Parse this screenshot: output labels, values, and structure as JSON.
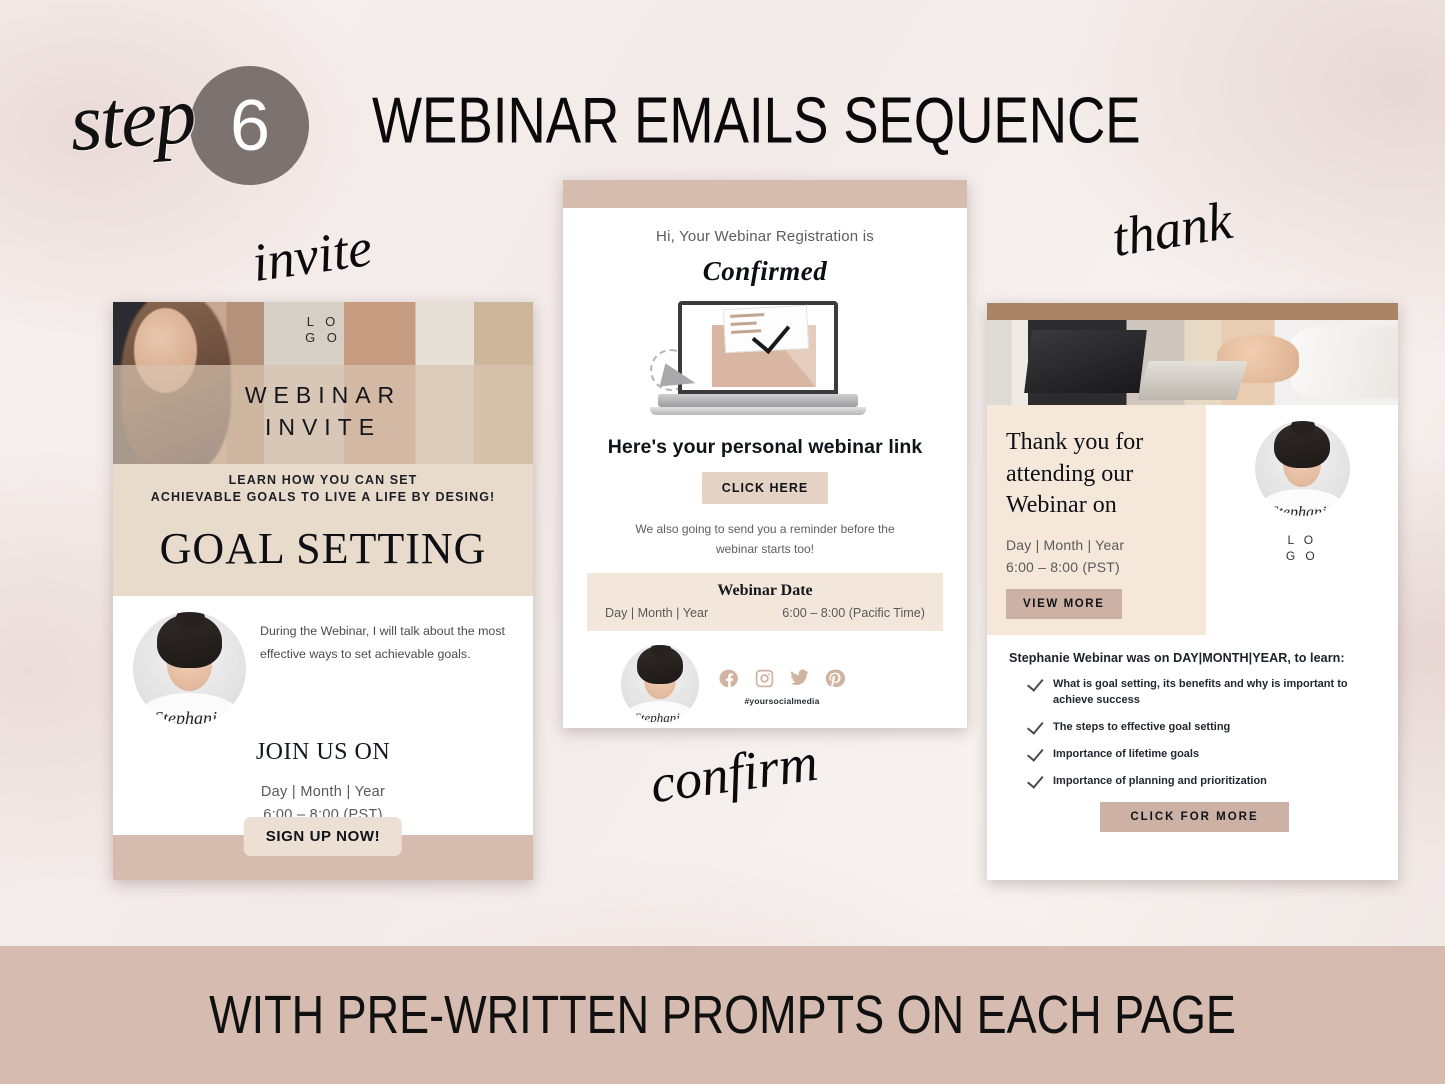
{
  "header": {
    "step_word": "step",
    "step_number": "6",
    "title": "WEBINAR EMAILS SEQUENCE"
  },
  "labels": {
    "invite": "invite",
    "thank": "thank",
    "confirm": "confirm"
  },
  "colors": {
    "background": "#f3ecea",
    "banner": "#d6bcb0",
    "badge": "#7c7270",
    "accent_tan": "#d6bcaf",
    "accent_cream": "#f5e7da",
    "cta_tan": "#ccb1a4"
  },
  "invite_card": {
    "logo_line1": "L O",
    "logo_line2": "G O",
    "overlay_line1": "WEBINAR",
    "overlay_line2": "INVITE",
    "sub_line1": "LEARN HOW YOU CAN SET",
    "sub_line2": "ACHIEVABLE GOALS TO LIVE A LIFE BY DESING!",
    "headline": "GOAL SETTING",
    "bio": "During the Webinar, I will talk about the most effective ways to set achievable goals.",
    "signature": "Stephanie",
    "join_label": "JOIN US ON",
    "date": "Day | Month | Year",
    "time": "6:00 – 8:00 (PST)",
    "cta": "SIGN UP NOW!"
  },
  "confirm_card": {
    "greeting": "Hi, Your Webinar Registration is",
    "status": "Confirmed",
    "link_heading": "Here's your personal webinar link",
    "cta": "CLICK HERE",
    "note": "We also going to send you a reminder before the webinar starts too!",
    "date_title": "Webinar Date",
    "date": "Day | Month | Year",
    "time": "6:00 – 8:00 (Pacific Time)",
    "signature": "Stephanie",
    "social_icons": [
      "facebook-icon",
      "instagram-icon",
      "twitter-icon",
      "pinterest-icon"
    ],
    "hashtag": "#yoursocialmedia",
    "logo_line1": "L O",
    "logo_line2": "G O"
  },
  "thank_card": {
    "title": "Thank you for attending our Webinar on",
    "date": "Day | Month | Year",
    "time": "6:00 – 8:00 (PST)",
    "cta": "VIEW MORE",
    "signature": "Stephanie",
    "logo_line1": "L O",
    "logo_line2": "G O",
    "lead": "Stephanie Webinar was on DAY|MONTH|YEAR, to learn:",
    "bullets": [
      "What is goal setting, its benefits and why is important to achieve success",
      "The steps to effective goal setting",
      "Importance of lifetime goals",
      "Importance of planning and prioritization"
    ],
    "cta2": "CLICK FOR MORE"
  },
  "footer": {
    "banner_text": "WITH PRE-WRITTEN PROMPTS ON EACH PAGE"
  }
}
